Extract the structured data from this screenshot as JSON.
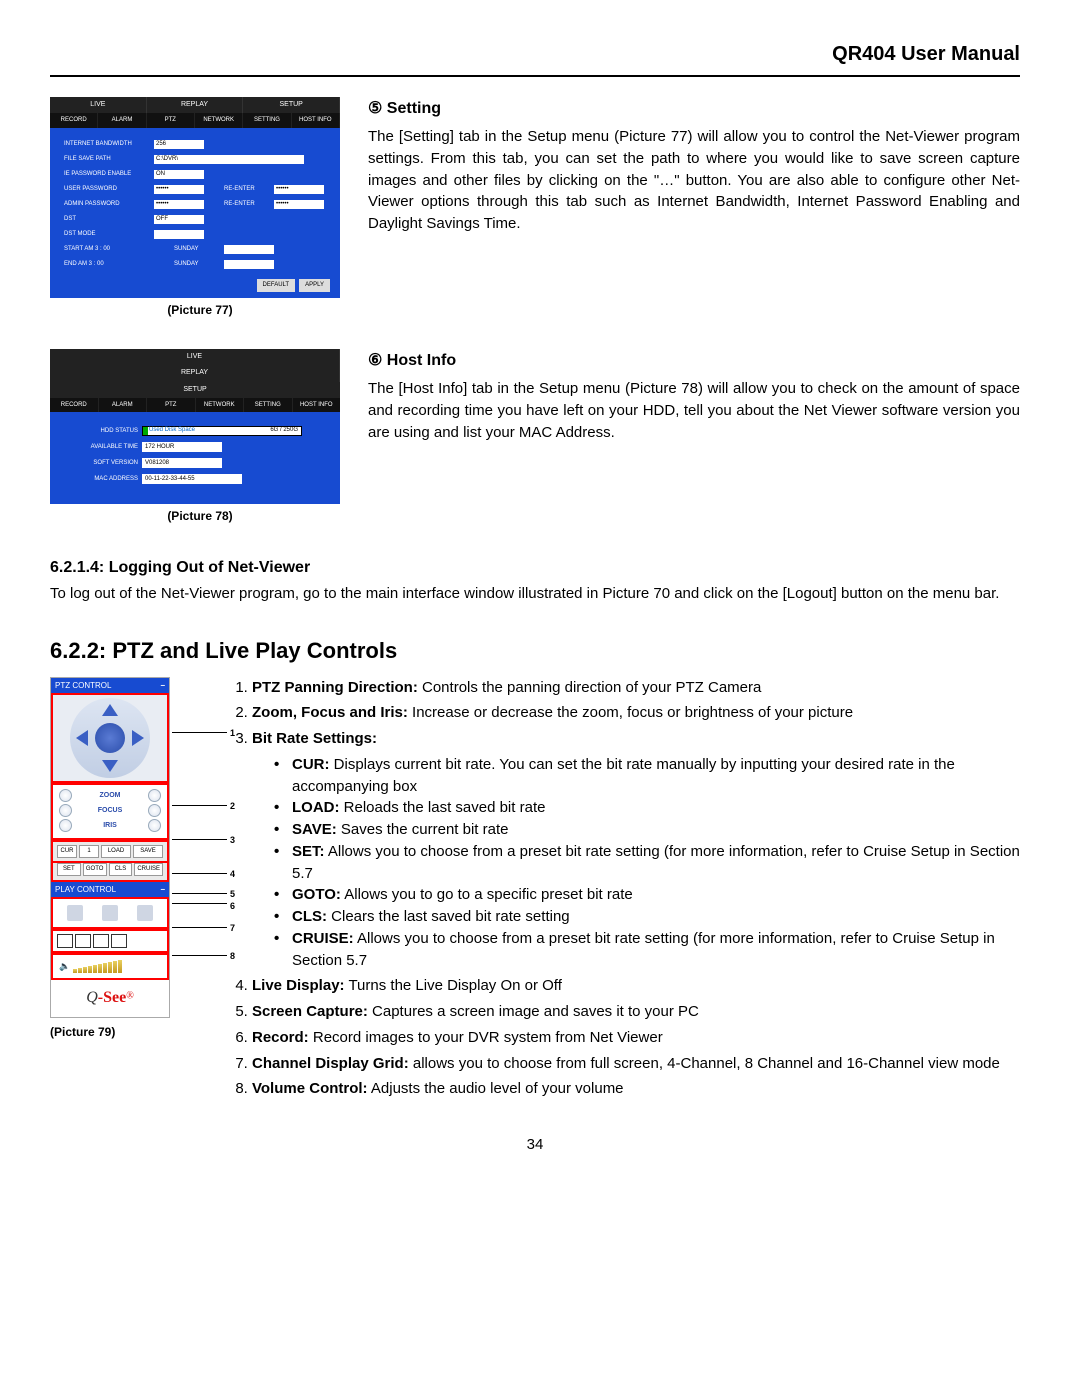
{
  "header": {
    "title": "QR404 User Manual"
  },
  "setting": {
    "num": "⑤",
    "title": "Setting",
    "body": "The [Setting] tab in the Setup menu (Picture 77) will allow you to control the Net-Viewer program settings. From this tab, you can set the path to where you would like to save screen capture images and other files by clicking on the \"…\" button. You are also able to configure other Net-Viewer options through this tab such as Internet Bandwidth, Internet Password Enabling and Daylight Savings Time."
  },
  "pic77": {
    "caption": "(Picture 77)",
    "tabs1": [
      "LIVE",
      "REPLAY",
      "SETUP"
    ],
    "tabs2": [
      "RECORD",
      "ALARM",
      "PTZ",
      "NETWORK",
      "SETTING",
      "HOST INFO"
    ],
    "rows": {
      "bandwidth_label": "INTERNET BANDWIDTH",
      "bandwidth_val": "256",
      "path_label": "FILE SAVE PATH",
      "path_val": "C:\\DVR\\",
      "iepw_label": "IE PASSWORD ENABLE",
      "iepw_val": "ON",
      "userpw_label": "USER PASSWORD",
      "userpw_val": "••••••",
      "reenter_label": "RE-ENTER",
      "reenter_val": "••••••",
      "adminpw_label": "ADMIN PASSWORD",
      "adminpw_val": "••••••",
      "reenter2_label": "RE-ENTER",
      "reenter2_val": "••••••",
      "dst_label": "DST",
      "dst_val": "OFF",
      "dstmode_label": "DST MODE",
      "start_label": "START   AM  3 : 00",
      "sunday_label": "SUNDAY",
      "end_label": "END     AM  3 : 00",
      "sunday2_label": "SUNDAY"
    },
    "btn_default": "DEFAULT",
    "btn_apply": "APPLY"
  },
  "hostinfo": {
    "num": "⑥",
    "title": "Host Info",
    "body": "The [Host Info] tab in the Setup menu (Picture 78) will allow you to check on the amount of space and recording time you have left on your HDD, tell you about the Net Viewer software version you are using and list your MAC Address."
  },
  "pic78": {
    "caption": "(Picture 78)",
    "tabs1": [
      "LIVE",
      "REPLAY",
      "SETUP"
    ],
    "tabs2": [
      "RECORD",
      "ALARM",
      "PTZ",
      "NETWORK",
      "SETTING",
      "HOST INFO"
    ],
    "hdd_label": "HDD STATUS",
    "hdd_text": "Used Disk Space",
    "hdd_total": "6G / 250G",
    "avail_label": "AVAILABLE TIME",
    "avail_val": "172 HOUR",
    "soft_label": "SOFT VERSION",
    "soft_val": "V081208",
    "mac_label": "MAC ADDRESS",
    "mac_val": "00-11-22-33-44-55"
  },
  "logout": {
    "heading": "6.2.1.4: Logging Out of Net-Viewer",
    "body": "To log out of the Net-Viewer program, go to the main interface window illustrated in Picture 70 and click on the [Logout] button on the menu bar."
  },
  "ptz": {
    "heading": "6.2.2: PTZ and Live Play Controls",
    "caption": "(Picture 79)",
    "panel": {
      "title_ptz": "PTZ CONTROL",
      "zoom": "ZOOM",
      "focus": "FOCUS",
      "iris": "IRIS",
      "cur": "CUR",
      "cur_val": "1",
      "load": "LOAD",
      "save": "SAVE",
      "set": "SET",
      "goto": "GOTO",
      "cls": "CLS",
      "cruise": "CRUISE",
      "title_play": "PLAY CONTROL",
      "logo_q": "Q",
      "logo_dash": "-",
      "logo_see": "See"
    },
    "callouts": {
      "1": "1",
      "2": "2",
      "3": "3",
      "4": "4",
      "5": "5",
      "6": "6",
      "7": "7",
      "8": "8"
    },
    "items": [
      {
        "label": "PTZ Panning Direction:",
        "text": " Controls the panning direction of your PTZ Camera"
      },
      {
        "label": "Zoom, Focus and Iris:",
        "text": "   Increase or decrease the zoom, focus or brightness of your picture"
      },
      {
        "label": "Bit Rate Settings:",
        "text": ""
      }
    ],
    "bitrate": [
      {
        "label": "CUR:",
        "text": " Displays current bit rate. You can set the bit rate manually by inputting your desired rate in the accompanying box"
      },
      {
        "label": "LOAD:",
        "text": " Reloads the last saved bit rate"
      },
      {
        "label": "SAVE:",
        "text": " Saves the current bit rate"
      },
      {
        "label": "SET:",
        "text": " Allows you to choose from a preset bit rate setting (for more information, refer to Cruise Setup in Section 5.7"
      },
      {
        "label": "GOTO:",
        "text": " Allows you to go to a specific preset bit rate"
      },
      {
        "label": "CLS:",
        "text": " Clears the last saved bit rate setting"
      },
      {
        "label": "CRUISE:",
        "text": " Allows you to choose from a preset bit rate setting (for more information, refer to Cruise Setup in Section 5.7"
      }
    ],
    "items2": [
      {
        "label": "Live Display:",
        "text": " Turns the Live Display On or Off"
      },
      {
        "label": "Screen Capture:",
        "text": " Captures a screen image and saves it to your PC"
      },
      {
        "label": "Record:",
        "text": " Record images to your DVR system from Net Viewer"
      },
      {
        "label": "Channel Display Grid:",
        "text": " allows you to choose from full screen, 4-Channel, 8 Channel and 16-Channel view mode"
      },
      {
        "label": "Volume Control:",
        "text": " Adjusts the audio level of your volume"
      }
    ]
  },
  "page_number": "34"
}
